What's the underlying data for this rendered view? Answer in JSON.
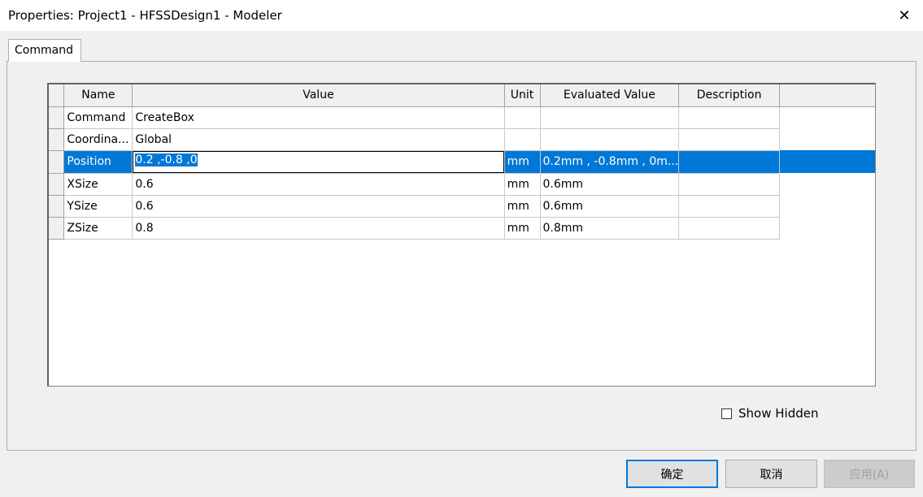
{
  "window": {
    "title": "Properties: Project1 - HFSSDesign1 - Modeler",
    "close_glyph": "✕"
  },
  "tabs": [
    {
      "label": "Command",
      "active": true
    }
  ],
  "grid": {
    "columns": [
      "Name",
      "Value",
      "Unit",
      "Evaluated Value",
      "Description"
    ],
    "rows": [
      {
        "name": "Command",
        "value": "CreateBox",
        "unit": "",
        "evaluated": "",
        "description": ""
      },
      {
        "name": "Coordina...",
        "value": "Global",
        "unit": "",
        "evaluated": "",
        "description": ""
      },
      {
        "name": "Position",
        "value": "0.2 ,-0.8 ,0",
        "unit": "mm",
        "evaluated": "0.2mm , -0.8mm , 0m...",
        "description": "",
        "selected": true,
        "editing": true
      },
      {
        "name": "XSize",
        "value": "0.6",
        "unit": "mm",
        "evaluated": "0.6mm",
        "description": ""
      },
      {
        "name": "YSize",
        "value": "0.6",
        "unit": "mm",
        "evaluated": "0.6mm",
        "description": ""
      },
      {
        "name": "ZSize",
        "value": "0.8",
        "unit": "mm",
        "evaluated": "0.8mm",
        "description": ""
      }
    ]
  },
  "show_hidden": {
    "label": "Show Hidden",
    "checked": false
  },
  "buttons": {
    "ok": "确定",
    "cancel": "取消",
    "apply": "应用(A)"
  },
  "colors": {
    "selection": "#0078d7",
    "background": "#f0f0f0",
    "accent_border": "#0078d7"
  }
}
